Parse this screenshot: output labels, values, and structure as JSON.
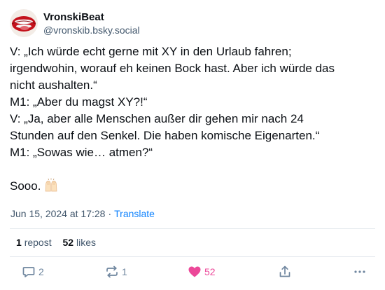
{
  "author": {
    "display_name": "VronskiBeat",
    "handle": "@vronskib.bsky.social"
  },
  "post": {
    "lines": [
      "V: „Ich würde echt gerne mit XY in den Urlaub fahren;",
      "irgendwohin, worauf eh keinen Bock hast. Aber ich würde das",
      "nicht aushalten.“",
      "M1: „Aber du magst XY?!“",
      "V: „Ja, aber alle Menschen außer dir gehen mir nach 24",
      "Stunden auf den Senkel. Die haben komische Eigenarten.“",
      "M1: „Sowas wie… atmen?“"
    ],
    "closing": "Sooo.",
    "closing_emoji": "raising-hands-icon"
  },
  "meta": {
    "timestamp": "Jun 15, 2024 at 17:28",
    "separator": "·",
    "translate_label": "Translate"
  },
  "stats": {
    "reposts_count": "1",
    "reposts_label": "repost",
    "likes_count": "52",
    "likes_label": "likes"
  },
  "actions": {
    "reply_count": "2",
    "repost_count": "1",
    "like_count": "52",
    "reply_icon": "reply-bubble-icon",
    "repost_icon": "repost-arrows-icon",
    "like_icon": "heart-icon",
    "share_icon": "share-icon",
    "more_icon": "more-dots-icon"
  },
  "colors": {
    "text_primary": "#0b0f14",
    "text_secondary": "#42576c",
    "link_blue": "#1083fe",
    "icon_gray": "#6f869f",
    "like_pink": "#ec4899",
    "divider": "#e3e8ed"
  }
}
